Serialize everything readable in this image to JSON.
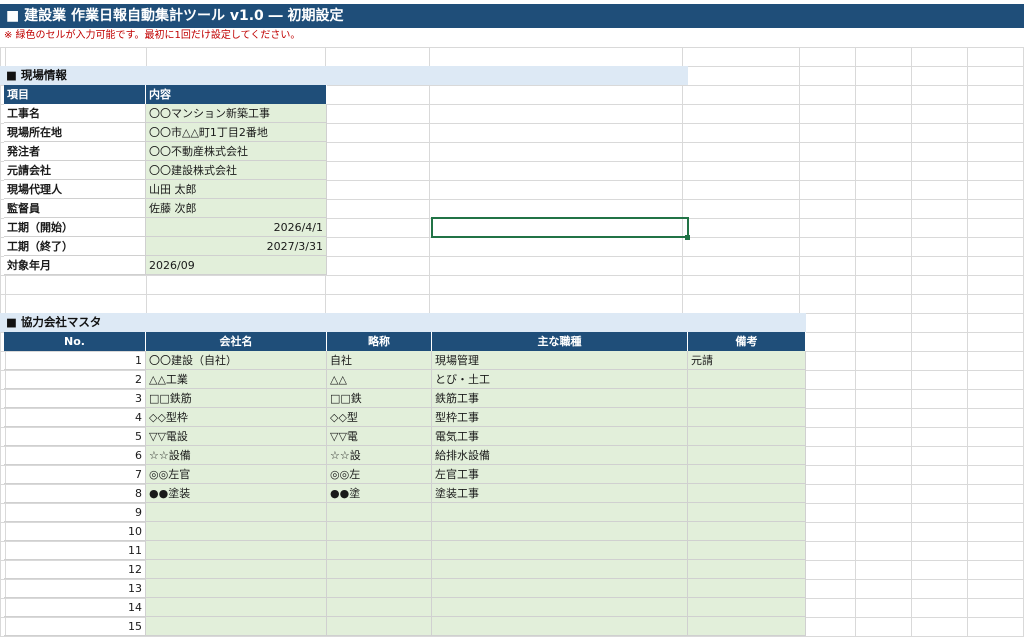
{
  "title": "■ 建設業 作業日報自動集計ツール v1.0 ― 初期設定",
  "note": "※ 緑色のセルが入力可能です。最初に1回だけ設定してください。",
  "site_info": {
    "section_title": "■ 現場情報",
    "header_item": "項目",
    "header_content": "内容",
    "rows": [
      {
        "label": "工事名",
        "value": "〇〇マンション新築工事"
      },
      {
        "label": "現場所在地",
        "value": "〇〇市△△町1丁目2番地"
      },
      {
        "label": "発注者",
        "value": "〇〇不動産株式会社"
      },
      {
        "label": "元請会社",
        "value": "〇〇建設株式会社"
      },
      {
        "label": "現場代理人",
        "value": "山田 太郎"
      },
      {
        "label": "監督員",
        "value": "佐藤 次郎"
      },
      {
        "label": "工期（開始）",
        "value": "2026/4/1"
      },
      {
        "label": "工期（終了）",
        "value": "2027/3/31"
      },
      {
        "label": "対象年月",
        "value": "2026/09"
      }
    ]
  },
  "partners": {
    "section_title": "■ 協力会社マスタ",
    "headers": [
      "No.",
      "会社名",
      "略称",
      "主な職種",
      "備考"
    ],
    "rows": [
      {
        "no": "1",
        "name": "〇〇建設（自社）",
        "short": "自社",
        "trade": "現場管理",
        "remark": "元請"
      },
      {
        "no": "2",
        "name": "△△工業",
        "short": "△△",
        "trade": "とび・土工",
        "remark": ""
      },
      {
        "no": "3",
        "name": "□□鉄筋",
        "short": "□□鉄",
        "trade": "鉄筋工事",
        "remark": ""
      },
      {
        "no": "4",
        "name": "◇◇型枠",
        "short": "◇◇型",
        "trade": "型枠工事",
        "remark": ""
      },
      {
        "no": "5",
        "name": "▽▽電設",
        "short": "▽▽電",
        "trade": "電気工事",
        "remark": ""
      },
      {
        "no": "6",
        "name": "☆☆設備",
        "short": "☆☆設",
        "trade": "給排水設備",
        "remark": ""
      },
      {
        "no": "7",
        "name": "◎◎左官",
        "short": "◎◎左",
        "trade": "左官工事",
        "remark": ""
      },
      {
        "no": "8",
        "name": "●●塗装",
        "short": "●●塗",
        "trade": "塗装工事",
        "remark": ""
      },
      {
        "no": "9",
        "name": "",
        "short": "",
        "trade": "",
        "remark": ""
      },
      {
        "no": "10",
        "name": "",
        "short": "",
        "trade": "",
        "remark": ""
      },
      {
        "no": "11",
        "name": "",
        "short": "",
        "trade": "",
        "remark": ""
      },
      {
        "no": "12",
        "name": "",
        "short": "",
        "trade": "",
        "remark": ""
      },
      {
        "no": "13",
        "name": "",
        "short": "",
        "trade": "",
        "remark": ""
      },
      {
        "no": "14",
        "name": "",
        "short": "",
        "trade": "",
        "remark": ""
      },
      {
        "no": "15",
        "name": "",
        "short": "",
        "trade": "",
        "remark": ""
      }
    ]
  },
  "colors": {
    "header_navy": "#1f4e79",
    "section_blue": "#dde9f5",
    "input_green": "#e2efda",
    "note_red": "#c00000",
    "selection_green": "#217346"
  }
}
